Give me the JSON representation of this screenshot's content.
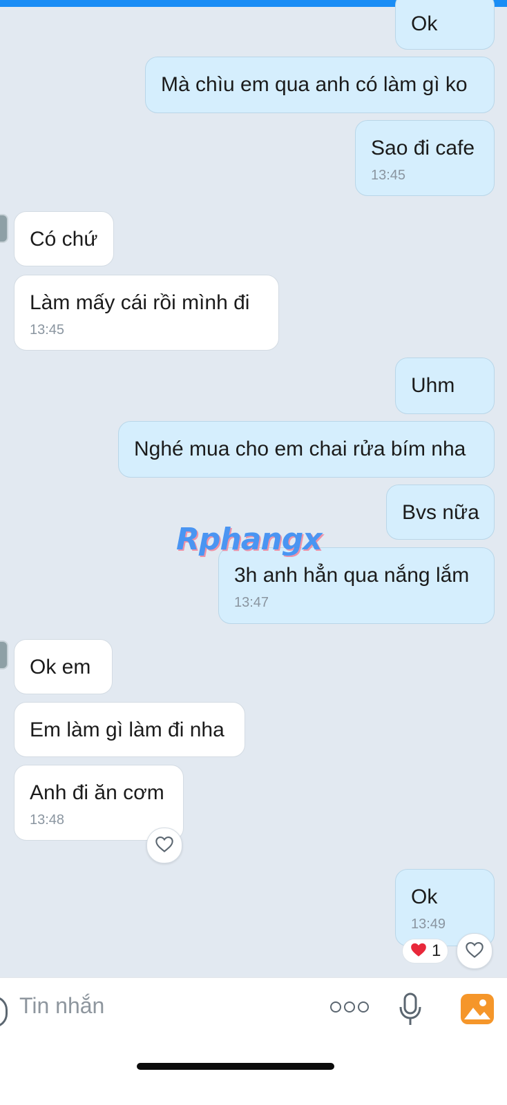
{
  "colors": {
    "background": "#e2e9f1",
    "outgoing_bubble": "#d5eefd",
    "incoming_bubble": "#ffffff",
    "accent": "#1a8df5",
    "watermark": "#3a8df3"
  },
  "messages": [
    {
      "direction": "out",
      "text": "Ok",
      "time": ""
    },
    {
      "direction": "out",
      "text": "Mà chìu em qua anh có làm gì ko",
      "time": ""
    },
    {
      "direction": "out",
      "text": "Sao đi cafe",
      "time": "13:45"
    },
    {
      "direction": "in",
      "text": "Có chứ",
      "time": ""
    },
    {
      "direction": "in",
      "text": "Làm mấy cái rồi mình đi",
      "time": "13:45"
    },
    {
      "direction": "out",
      "text": "Uhm",
      "time": ""
    },
    {
      "direction": "out",
      "text": "Nghé mua cho em chai rửa bím nha",
      "time": ""
    },
    {
      "direction": "out",
      "text": "Bvs nữa",
      "time": ""
    },
    {
      "direction": "out",
      "text": "3h anh hẳn qua nắng lắm",
      "time": "13:47"
    },
    {
      "direction": "in",
      "text": "Ok em",
      "time": ""
    },
    {
      "direction": "in",
      "text": "Em làm gì làm đi nha",
      "time": ""
    },
    {
      "direction": "in",
      "text": "Anh đi ăn cơm",
      "time": "13:48"
    },
    {
      "direction": "out",
      "text": "Ok",
      "time": "13:49"
    }
  ],
  "watermark": "Rphangx",
  "reaction": {
    "icon": "red-heart-icon",
    "count": "1"
  },
  "composer": {
    "placeholder": "Tin nhắn",
    "icons": [
      "emoji-icon",
      "more-icon",
      "microphone-icon",
      "image-icon"
    ]
  }
}
